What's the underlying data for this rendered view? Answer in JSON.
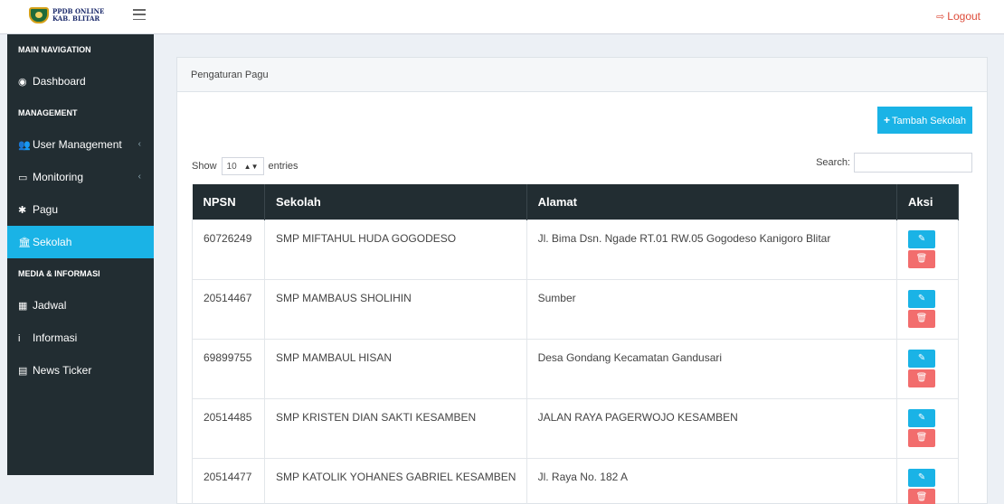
{
  "brand": {
    "line1": "PPDB ONLINE",
    "line2": "KAB. BLITAR"
  },
  "topbar": {
    "logout_label": "Logout"
  },
  "sidebar": {
    "items": [
      {
        "kind": "header",
        "label": "MAIN NAVIGATION"
      },
      {
        "kind": "link",
        "label": "Dashboard",
        "icon": "dashboard-icon",
        "glyph": "◉"
      },
      {
        "kind": "header",
        "label": "MANAGEMENT"
      },
      {
        "kind": "link",
        "label": "User Management",
        "icon": "users-icon",
        "glyph": "👥",
        "chevron": true
      },
      {
        "kind": "link",
        "label": "Monitoring",
        "icon": "desktop-icon",
        "glyph": "▭",
        "chevron": true
      },
      {
        "kind": "link",
        "label": "Pagu",
        "icon": "gear-icon",
        "glyph": "✱"
      },
      {
        "kind": "link",
        "label": "Sekolah",
        "icon": "institution-icon",
        "glyph": "🏛",
        "active": true
      },
      {
        "kind": "header",
        "label": "MEDIA & INFORMASI"
      },
      {
        "kind": "link",
        "label": "Jadwal",
        "icon": "calendar-icon",
        "glyph": "▦"
      },
      {
        "kind": "link",
        "label": "Informasi",
        "icon": "info-icon",
        "glyph": "i"
      },
      {
        "kind": "link",
        "label": "News Ticker",
        "icon": "newspaper-icon",
        "glyph": "▤"
      }
    ]
  },
  "panel": {
    "title": "Pengaturan Pagu",
    "add_button": "Tambah Sekolah",
    "show_label": "Show",
    "entries_value": "10",
    "entries_label": "entries",
    "search_label": "Search:",
    "search_value": ""
  },
  "table": {
    "columns": [
      "NPSN",
      "Sekolah",
      "Alamat",
      "Aksi"
    ],
    "rows": [
      {
        "npsn": "60726249",
        "sekolah": "SMP MIFTAHUL HUDA GOGODESO",
        "alamat": "Jl. Bima Dsn. Ngade RT.01 RW.05 Gogodeso Kanigoro Blitar"
      },
      {
        "npsn": "20514467",
        "sekolah": "SMP MAMBAUS SHOLIHIN",
        "alamat": "Sumber"
      },
      {
        "npsn": "69899755",
        "sekolah": "SMP MAMBAUL HISAN",
        "alamat": "Desa Gondang Kecamatan Gandusari"
      },
      {
        "npsn": "20514485",
        "sekolah": "SMP KRISTEN DIAN SAKTI KESAMBEN",
        "alamat": "JALAN RAYA PAGERWOJO KESAMBEN"
      },
      {
        "npsn": "20514477",
        "sekolah": "SMP KATOLIK YOHANES GABRIEL KESAMBEN",
        "alamat": "Jl. Raya No. 182 A"
      }
    ]
  },
  "colors": {
    "accent": "#1ab3e6",
    "sidebar": "#222d32",
    "danger": "#f26d6d",
    "logout": "#dd4b39"
  }
}
